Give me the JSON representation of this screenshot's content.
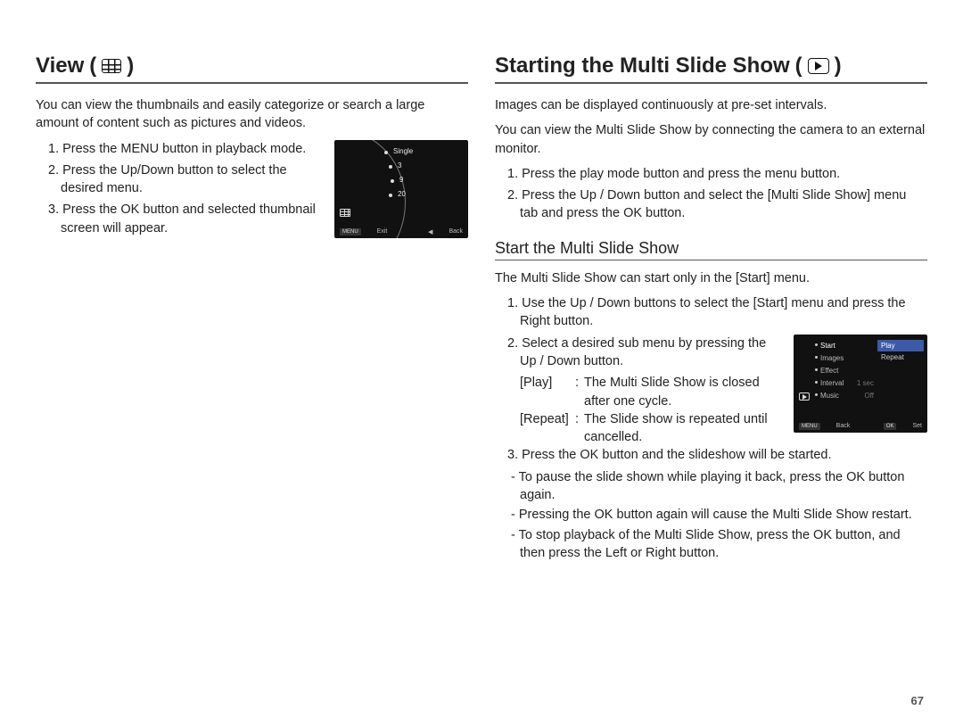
{
  "page_number": "67",
  "left": {
    "heading": "View",
    "heading_paren_open": "(",
    "heading_paren_close": ")",
    "intro": "You can view the thumbnails and easily categorize or search a large amount of content such as pictures and videos.",
    "steps": [
      "1. Press the MENU button in playback mode.",
      "2. Press the Up/Down button to select the desired menu.",
      "3. Press the OK button and selected thumbnail screen will appear."
    ],
    "screen": {
      "rows": [
        "Single",
        "3",
        "9",
        "20"
      ],
      "footer_exit": "Exit",
      "footer_back": "Back",
      "menu_tag": "MENU"
    }
  },
  "right": {
    "heading": "Starting the Multi Slide Show",
    "heading_paren_open": "(",
    "heading_paren_close": ")",
    "intro1": "Images can be displayed continuously at pre-set intervals.",
    "intro2": "You can view the Multi Slide Show by connecting the camera to an external monitor.",
    "steps_top": [
      "1. Press the play mode button and press the menu button.",
      "2. Press the Up / Down button and select the [Multi Slide Show] menu tab and press the OK button."
    ],
    "subheading": "Start the Multi Slide Show",
    "sub_intro": "The Multi Slide Show can start only in the [Start] menu.",
    "step1": "1. Use the Up / Down buttons to select the [Start] menu and press the Right button.",
    "step2": "2. Select a desired sub menu by pressing the Up / Down button.",
    "defs": [
      {
        "key": "[Play]",
        "val": "The Multi Slide Show is closed after one cycle."
      },
      {
        "key": "[Repeat]",
        "val": "The Slide show is repeated until cancelled."
      }
    ],
    "step3": "3. Press the OK button and the slideshow will be started.",
    "step3_subs": [
      "- To pause the slide shown while playing it back, press the OK button again.",
      "- Pressing the OK button again will cause the Multi Slide Show restart.",
      "- To stop playback of the Multi Slide Show, press the OK button, and then press the Left or Right button."
    ],
    "screen": {
      "left_items": [
        "Start",
        "Images",
        "Effect",
        "Interval",
        "Music"
      ],
      "left_vals": [
        "",
        "",
        "",
        "1 sec",
        "Off"
      ],
      "right_items": [
        "Play",
        "Repeat"
      ],
      "footer_back": "Back",
      "footer_set": "Set",
      "menu_tag": "MENU",
      "ok_tag": "OK"
    }
  }
}
